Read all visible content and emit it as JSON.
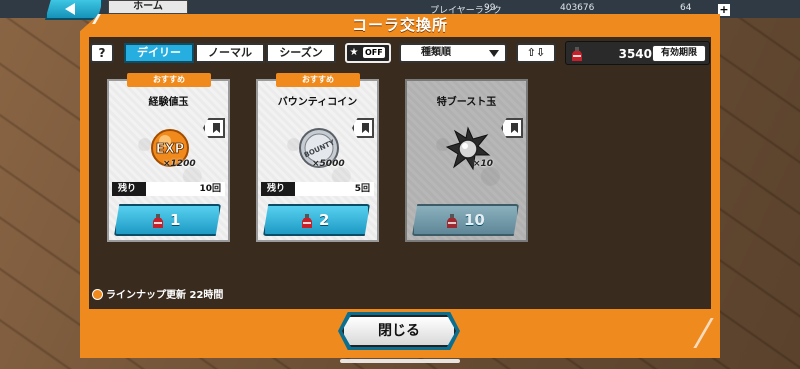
{
  "top_bar": {
    "home_label": "ホーム",
    "player_rank_label": "プレイヤーランク",
    "player_rank_value": "99",
    "coins_value": "403676",
    "gems_value": "64"
  },
  "dialog": {
    "title": "コーラ交換所"
  },
  "filters": {
    "help_label": "?",
    "tabs": [
      {
        "label": "デイリー",
        "active": true
      },
      {
        "label": "ノーマル",
        "active": false
      },
      {
        "label": "シーズン",
        "active": false
      }
    ],
    "favorite_toggle": "OFF",
    "sort_value": "種類順",
    "order_label": "⇧⇩"
  },
  "currency": {
    "amount": "3540",
    "expiry_label": "有効期限"
  },
  "items": [
    {
      "badge": "おすすめ",
      "name": "経験値玉",
      "icon": "exp-orb-icon",
      "quantity": "×1200",
      "remain_label": "残り",
      "remain_value": "10回",
      "price": "1",
      "disabled": false
    },
    {
      "badge": "おすすめ",
      "name": "バウンティコイン",
      "icon": "bounty-coin-icon",
      "quantity": "×5000",
      "remain_label": "残り",
      "remain_value": "5回",
      "price": "2",
      "disabled": false
    },
    {
      "badge": "",
      "name": "特ブースト玉",
      "icon": "boost-orb-icon",
      "quantity": "×10",
      "remain_label": "",
      "remain_value": "",
      "price": "10",
      "disabled": true
    }
  ],
  "footer": {
    "lineup_text": "ラインナップ更新 22時間",
    "close_label": "閉じる"
  },
  "colors": {
    "frame_orange": "#ef8a1f",
    "button_blue": "#27aee0",
    "panel_dark": "#1c1c20"
  }
}
